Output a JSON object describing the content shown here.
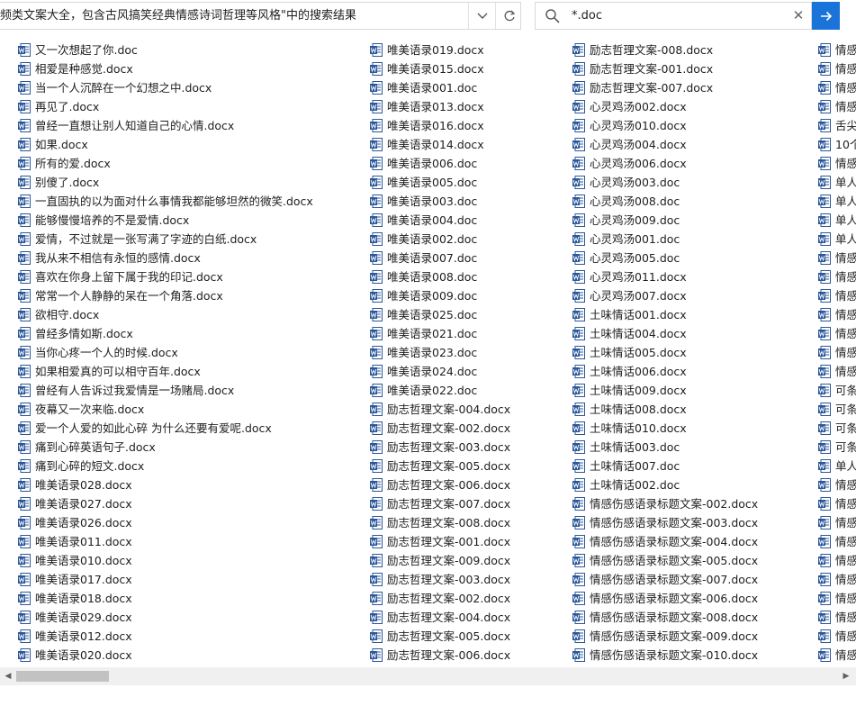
{
  "address": {
    "path_text": "频类文案大全，包含古风搞笑经典情感诗词哲理等风格\"中的搜索结果",
    "chevron": "›"
  },
  "search": {
    "value": "*.doc",
    "clear_glyph": "✕"
  },
  "columns": [
    [
      "又一次想起了你.doc",
      "相爱是种感觉.docx",
      "当一个人沉醉在一个幻想之中.docx",
      "再见了.docx",
      "曾经一直想让别人知道自己的心情.docx",
      "如果.docx",
      "所有的爱.docx",
      "别傻了.docx",
      "一直固执的以为面对什么事情我都能够坦然的微笑.docx",
      "能够慢慢培养的不是爱情.docx",
      "爱情，不过就是一张写满了字迹的白纸.docx",
      "我从来不相信有永恒的感情.docx",
      "喜欢在你身上留下属于我的印记.docx",
      "常常一个人静静的呆在一个角落.docx",
      "欲相守.docx",
      "曾经多情如斯.docx",
      "当你心疼一个人的时候.docx",
      "如果相爱真的可以相守百年.docx",
      "曾经有人告诉过我爱情是一场赌局.docx",
      "夜幕又一次来临.docx",
      "爱一个人爱的如此心碎 为什么还要有爱呢.docx",
      "痛到心碎英语句子.docx",
      "痛到心碎的短文.docx",
      "唯美语录028.docx",
      "唯美语录027.docx",
      "唯美语录026.docx",
      "唯美语录011.docx",
      "唯美语录010.docx",
      "唯美语录017.docx",
      "唯美语录018.docx",
      "唯美语录029.docx",
      "唯美语录012.docx",
      "唯美语录020.docx"
    ],
    [
      "唯美语录019.docx",
      "唯美语录015.docx",
      "唯美语录001.doc",
      "唯美语录013.docx",
      "唯美语录016.docx",
      "唯美语录014.docx",
      "唯美语录006.doc",
      "唯美语录005.doc",
      "唯美语录003.doc",
      "唯美语录004.doc",
      "唯美语录002.doc",
      "唯美语录007.doc",
      "唯美语录008.doc",
      "唯美语录009.doc",
      "唯美语录025.doc",
      "唯美语录021.doc",
      "唯美语录023.doc",
      "唯美语录024.doc",
      "唯美语录022.doc",
      "励志哲理文案-004.docx",
      "励志哲理文案-002.docx",
      "励志哲理文案-003.docx",
      "励志哲理文案-005.docx",
      "励志哲理文案-006.docx",
      "励志哲理文案-007.docx",
      "励志哲理文案-008.docx",
      "励志哲理文案-001.docx",
      "励志哲理文案-009.docx",
      "励志哲理文案-003.docx",
      "励志哲理文案-002.docx",
      "励志哲理文案-004.docx",
      "励志哲理文案-005.docx",
      "励志哲理文案-006.docx"
    ],
    [
      "励志哲理文案-008.docx",
      "励志哲理文案-001.docx",
      "励志哲理文案-007.docx",
      "心灵鸡汤002.docx",
      "心灵鸡汤010.docx",
      "心灵鸡汤004.docx",
      "心灵鸡汤006.docx",
      "心灵鸡汤003.doc",
      "心灵鸡汤008.doc",
      "心灵鸡汤009.doc",
      "心灵鸡汤001.doc",
      "心灵鸡汤005.doc",
      "心灵鸡汤011.docx",
      "心灵鸡汤007.docx",
      "土味情话001.docx",
      "土味情话004.docx",
      "土味情话005.docx",
      "土味情话006.docx",
      "土味情话009.docx",
      "土味情话008.docx",
      "土味情话010.docx",
      "土味情话003.doc",
      "土味情话007.doc",
      "土味情话002.doc",
      "情感伤感语录标题文案-002.docx",
      "情感伤感语录标题文案-003.docx",
      "情感伤感语录标题文案-004.docx",
      "情感伤感语录标题文案-005.docx",
      "情感伤感语录标题文案-007.docx",
      "情感伤感语录标题文案-006.docx",
      "情感伤感语录标题文案-008.docx",
      "情感伤感语录标题文案-009.docx",
      "情感伤感语录标题文案-010.docx"
    ],
    [
      "情感",
      "情感",
      "情感",
      "情感",
      "舌尖",
      "10个",
      "情感",
      "单人",
      "单人",
      "单人",
      "单人",
      "情感",
      "情感",
      "情感",
      "情感",
      "情感",
      "情感",
      "情感",
      "可条",
      "可条",
      "可条",
      "可条",
      "单人",
      "情感",
      "情感",
      "情感",
      "情感",
      "情感",
      "情感",
      "情感",
      "情感",
      "情感",
      "情感"
    ]
  ],
  "scrollbar": {
    "left_arrow": "◀",
    "right_arrow": "▶"
  },
  "colors": {
    "accent": "#1a73d9",
    "word_icon": "#2b579a"
  },
  "icons": {
    "file": "word-doc-icon",
    "search": "search-icon",
    "go": "arrow-right-icon",
    "refresh": "refresh-icon",
    "dropdown": "chevron-down-icon",
    "clear": "close-icon"
  }
}
